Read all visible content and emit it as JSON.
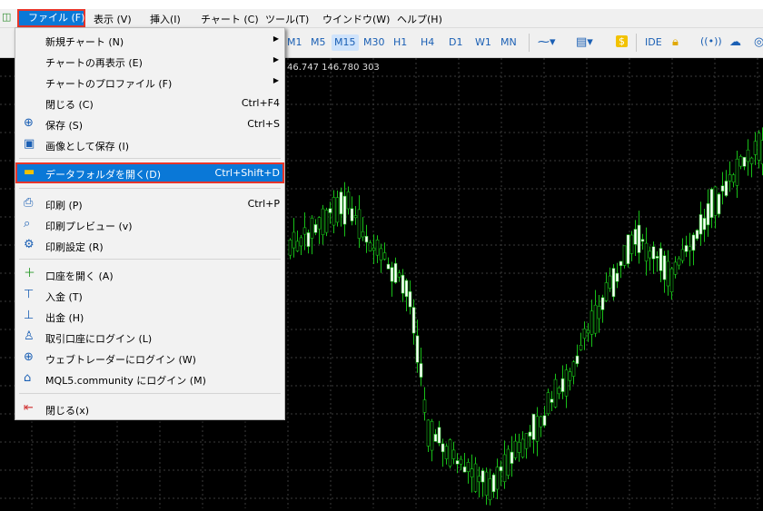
{
  "menubar": {
    "items": [
      {
        "label": "ファイル (F)"
      },
      {
        "label": "表示 (V)"
      },
      {
        "label": "挿入(I)"
      },
      {
        "label": "チャート (C)"
      },
      {
        "label": "ツール(T)"
      },
      {
        "label": "ウインドウ(W)"
      },
      {
        "label": "ヘルプ(H)"
      }
    ]
  },
  "toolbar": {
    "timeframes": [
      "M1",
      "M5",
      "M15",
      "M30",
      "H1",
      "H4",
      "D1",
      "W1",
      "MN"
    ],
    "active_timeframe": "M15",
    "ide_label": "IDE"
  },
  "chart": {
    "price_text": "46.747 146.780 303",
    "colors": {
      "bull": "#ffffff",
      "bear": "#18c018",
      "background": "#000000",
      "grid": "#3b3b3b"
    }
  },
  "file_menu": {
    "items": [
      {
        "label": "新規チャート (N)",
        "submenu": true,
        "icon": ""
      },
      {
        "label": "チャートの再表示 (E)",
        "submenu": true,
        "icon": ""
      },
      {
        "label": "チャートのプロファイル (F)",
        "submenu": true,
        "icon": ""
      },
      {
        "label": "閉じる (C)",
        "shortcut": "Ctrl+F4",
        "icon": ""
      },
      {
        "label": "保存 (S)",
        "shortcut": "Ctrl+S",
        "icon": "save-icon"
      },
      {
        "label": "画像として保存 (I)",
        "icon": "image-icon"
      },
      {
        "label": "データフォルダを開く(D)",
        "shortcut": "Ctrl+Shift+D",
        "icon": "folder-icon",
        "highlighted": true
      },
      {
        "label": "印刷 (P)",
        "shortcut": "Ctrl+P",
        "icon": "printer-icon"
      },
      {
        "label": "印刷プレビュー (v)",
        "icon": "print-preview-icon"
      },
      {
        "label": "印刷設定 (R)",
        "icon": "print-settings-icon"
      },
      {
        "label": "口座を開く (A)",
        "icon": "plus-icon"
      },
      {
        "label": "入金 (T)",
        "icon": "deposit-icon"
      },
      {
        "label": "出金 (H)",
        "icon": "withdraw-icon"
      },
      {
        "label": "取引口座にログイン (L)",
        "icon": "user-icon"
      },
      {
        "label": "ウェブトレーダーにログイン (W)",
        "icon": "globe-icon"
      },
      {
        "label": "MQL5.community にログイン (M)",
        "icon": "graduation-cap-icon"
      },
      {
        "label": "閉じる(x)",
        "icon": "exit-icon"
      }
    ]
  }
}
